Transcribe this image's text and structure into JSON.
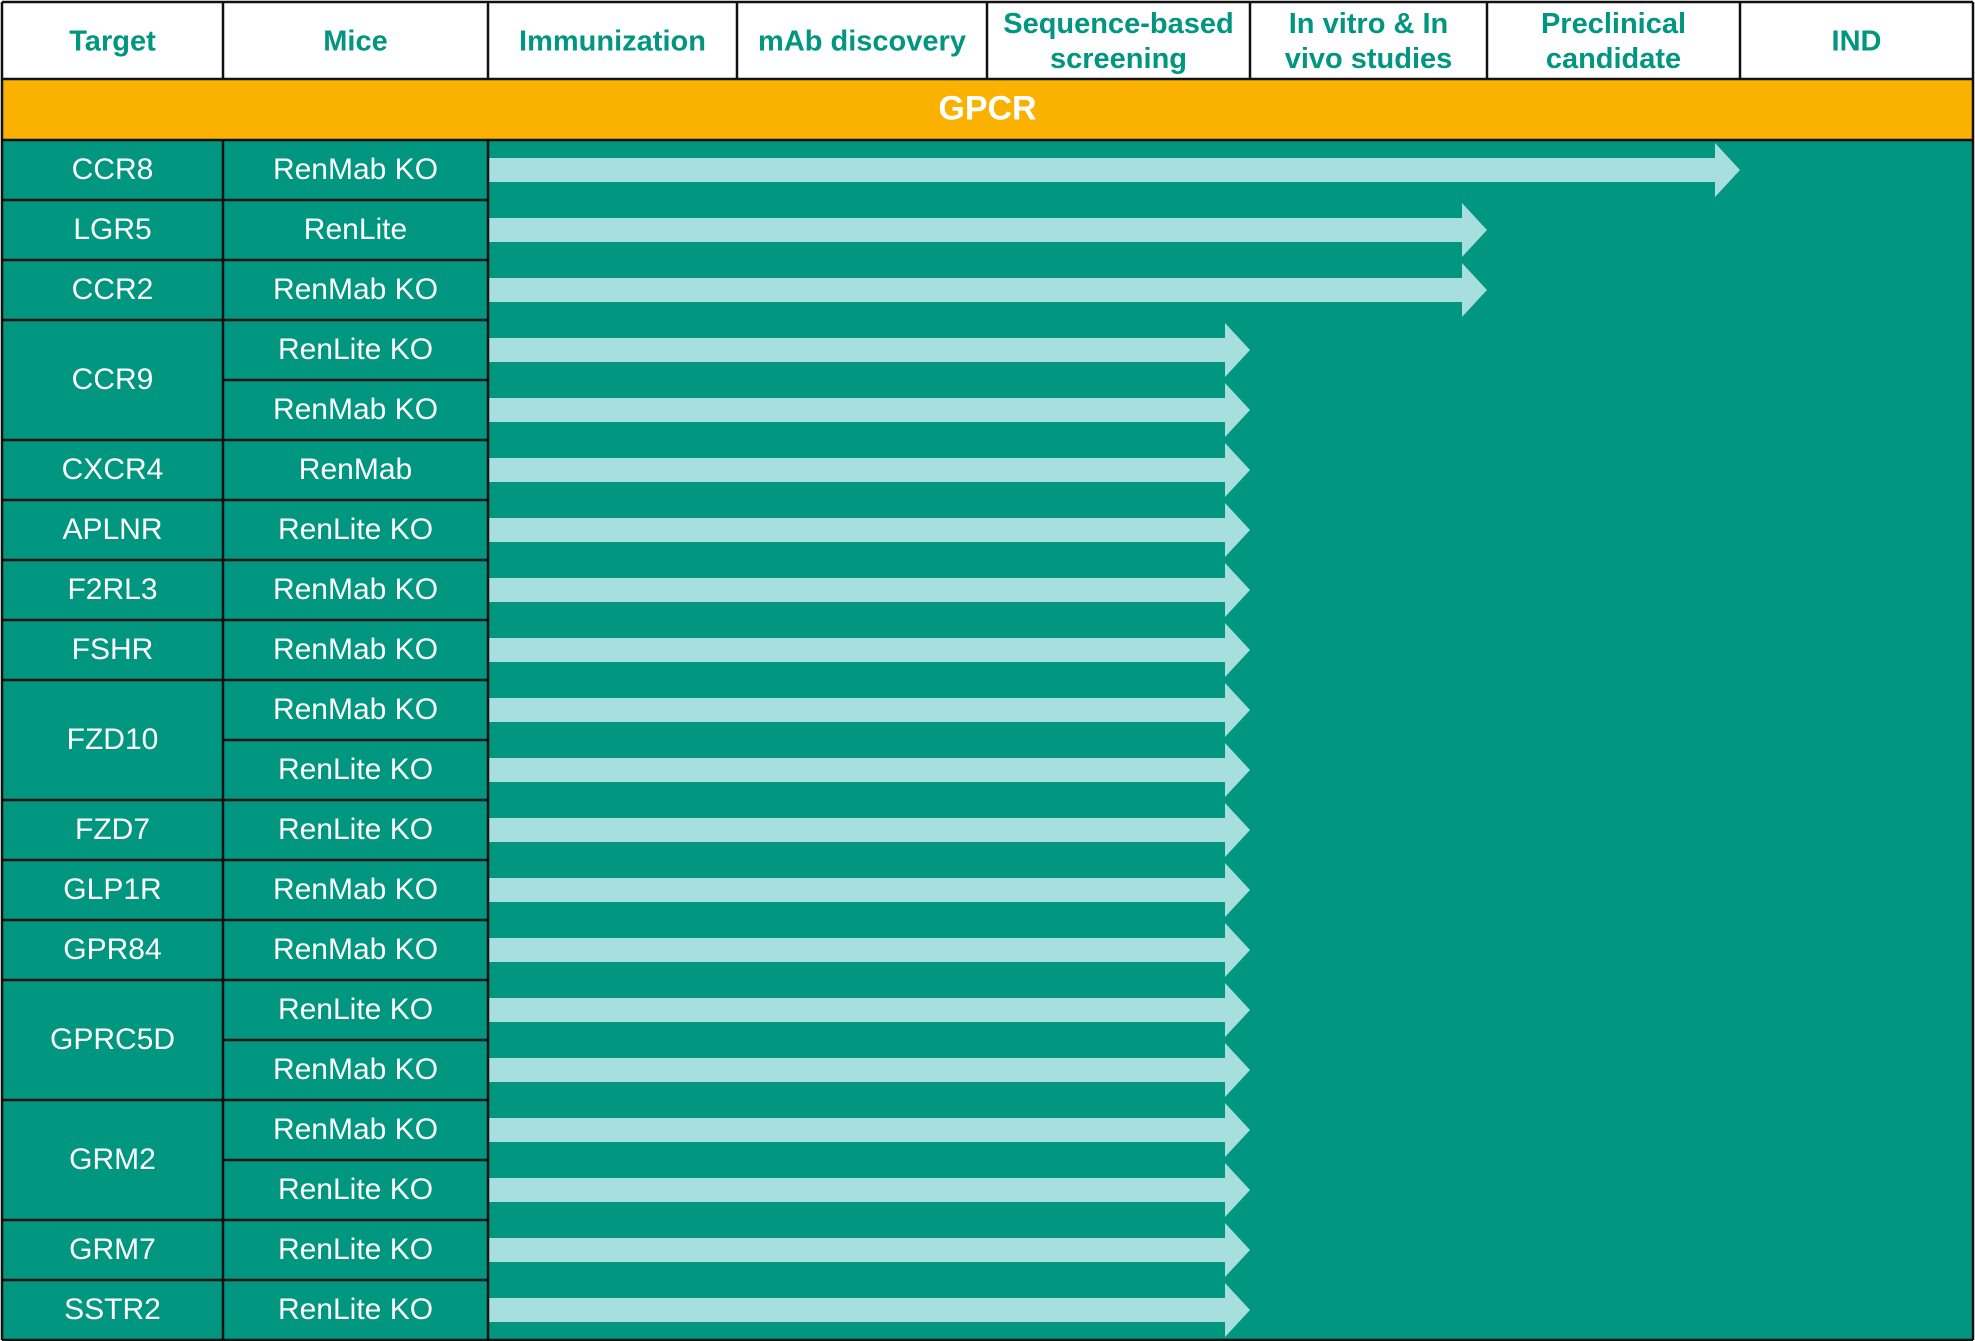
{
  "chart_data": {
    "type": "table",
    "stages": [
      [
        "Target"
      ],
      [
        "Mice"
      ],
      [
        "Immunization"
      ],
      [
        "mAb discovery"
      ],
      [
        "Sequence-based",
        "screening"
      ],
      [
        "In vitro & In",
        "vivo studies"
      ],
      [
        "Preclinical",
        "candidate"
      ],
      [
        "IND"
      ]
    ],
    "category": "GPCR",
    "rows": [
      {
        "target": "CCR8",
        "mice": [
          "RenMab KO"
        ],
        "progress": [
          7
        ]
      },
      {
        "target": "LGR5",
        "mice": [
          "RenLite"
        ],
        "progress": [
          6
        ]
      },
      {
        "target": "CCR2",
        "mice": [
          "RenMab KO"
        ],
        "progress": [
          6
        ]
      },
      {
        "target": "CCR9",
        "mice": [
          "RenLite KO",
          "RenMab KO"
        ],
        "progress": [
          5,
          5
        ]
      },
      {
        "target": "CXCR4",
        "mice": [
          "RenMab"
        ],
        "progress": [
          5
        ]
      },
      {
        "target": "APLNR",
        "mice": [
          "RenLite KO"
        ],
        "progress": [
          5
        ]
      },
      {
        "target": "F2RL3",
        "mice": [
          "RenMab KO"
        ],
        "progress": [
          5
        ]
      },
      {
        "target": "FSHR",
        "mice": [
          "RenMab KO"
        ],
        "progress": [
          5
        ]
      },
      {
        "target": "FZD10",
        "mice": [
          "RenMab KO",
          "RenLite KO"
        ],
        "progress": [
          5,
          5
        ]
      },
      {
        "target": "FZD7",
        "mice": [
          "RenLite KO"
        ],
        "progress": [
          5
        ]
      },
      {
        "target": "GLP1R",
        "mice": [
          "RenMab KO"
        ],
        "progress": [
          5
        ]
      },
      {
        "target": "GPR84",
        "mice": [
          "RenMab KO"
        ],
        "progress": [
          5
        ]
      },
      {
        "target": "GPRC5D",
        "mice": [
          "RenLite KO",
          "RenMab KO"
        ],
        "progress": [
          5,
          5
        ]
      },
      {
        "target": "GRM2",
        "mice": [
          "RenMab KO",
          "RenLite KO"
        ],
        "progress": [
          5,
          5
        ]
      },
      {
        "target": "GRM7",
        "mice": [
          "RenLite KO"
        ],
        "progress": [
          5
        ]
      },
      {
        "target": "SSTR2",
        "mice": [
          "RenLite KO"
        ],
        "progress": [
          5
        ]
      }
    ]
  },
  "colors": {
    "header_bg": "#ffffff",
    "header_text": "#00967f",
    "band": "#fbb100",
    "band_text": "#ffffff",
    "body_bg": "#00967f",
    "arrow": "#a6dfde",
    "grid": "#111111",
    "cell_text": "#ffffff"
  }
}
